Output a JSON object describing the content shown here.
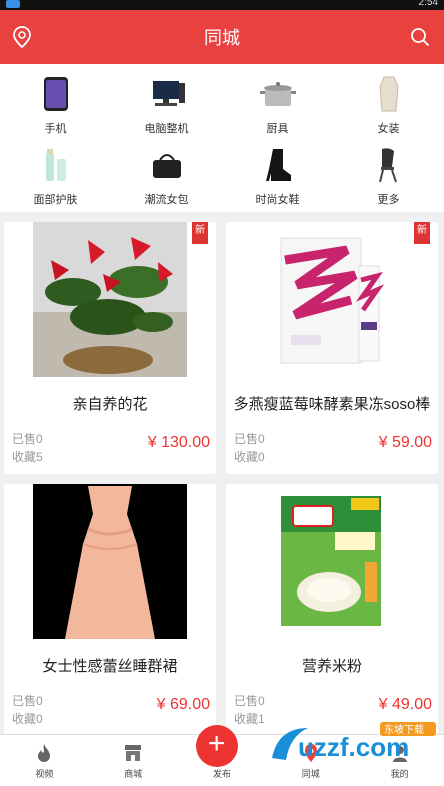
{
  "status_bar": {
    "time": "2:54"
  },
  "header": {
    "title": "同城"
  },
  "categories": [
    {
      "label": "手机",
      "icon": "phone-icon"
    },
    {
      "label": "电脑整机",
      "icon": "computer-icon"
    },
    {
      "label": "厨具",
      "icon": "pot-icon"
    },
    {
      "label": "女装",
      "icon": "coat-icon"
    },
    {
      "label": "面部护肤",
      "icon": "skincare-icon"
    },
    {
      "label": "潮流女包",
      "icon": "handbag-icon"
    },
    {
      "label": "时尚女鞋",
      "icon": "boot-icon"
    },
    {
      "label": "更多",
      "icon": "chair-icon"
    }
  ],
  "products": [
    {
      "name": "亲自养的花",
      "price": "¥ 130.00",
      "sold": "已售0",
      "fav": "收藏5",
      "badge": "新"
    },
    {
      "name": "多燕瘦蓝莓味酵素果冻soso棒",
      "price": "¥ 59.00",
      "sold": "已售0",
      "fav": "收藏0",
      "badge": "新"
    },
    {
      "name": "女士性感蕾丝睡群裙",
      "price": "¥ 69.00",
      "sold": "已售0",
      "fav": "收藏0"
    },
    {
      "name": "营养米粉",
      "price": "¥ 49.00",
      "sold": "已售0",
      "fav": "收藏1"
    }
  ],
  "tabs": [
    {
      "label": "视频",
      "icon": "flame-icon"
    },
    {
      "label": "商城",
      "icon": "store-icon"
    },
    {
      "label": "发布",
      "icon": "plus-icon"
    },
    {
      "label": "同城",
      "icon": "location-icon"
    },
    {
      "label": "我的",
      "icon": "user-icon"
    }
  ],
  "watermark": {
    "brand": "uzzf.com",
    "tag": "东坡下载"
  },
  "colors": {
    "brand": "#e94040",
    "price": "#e33333"
  }
}
